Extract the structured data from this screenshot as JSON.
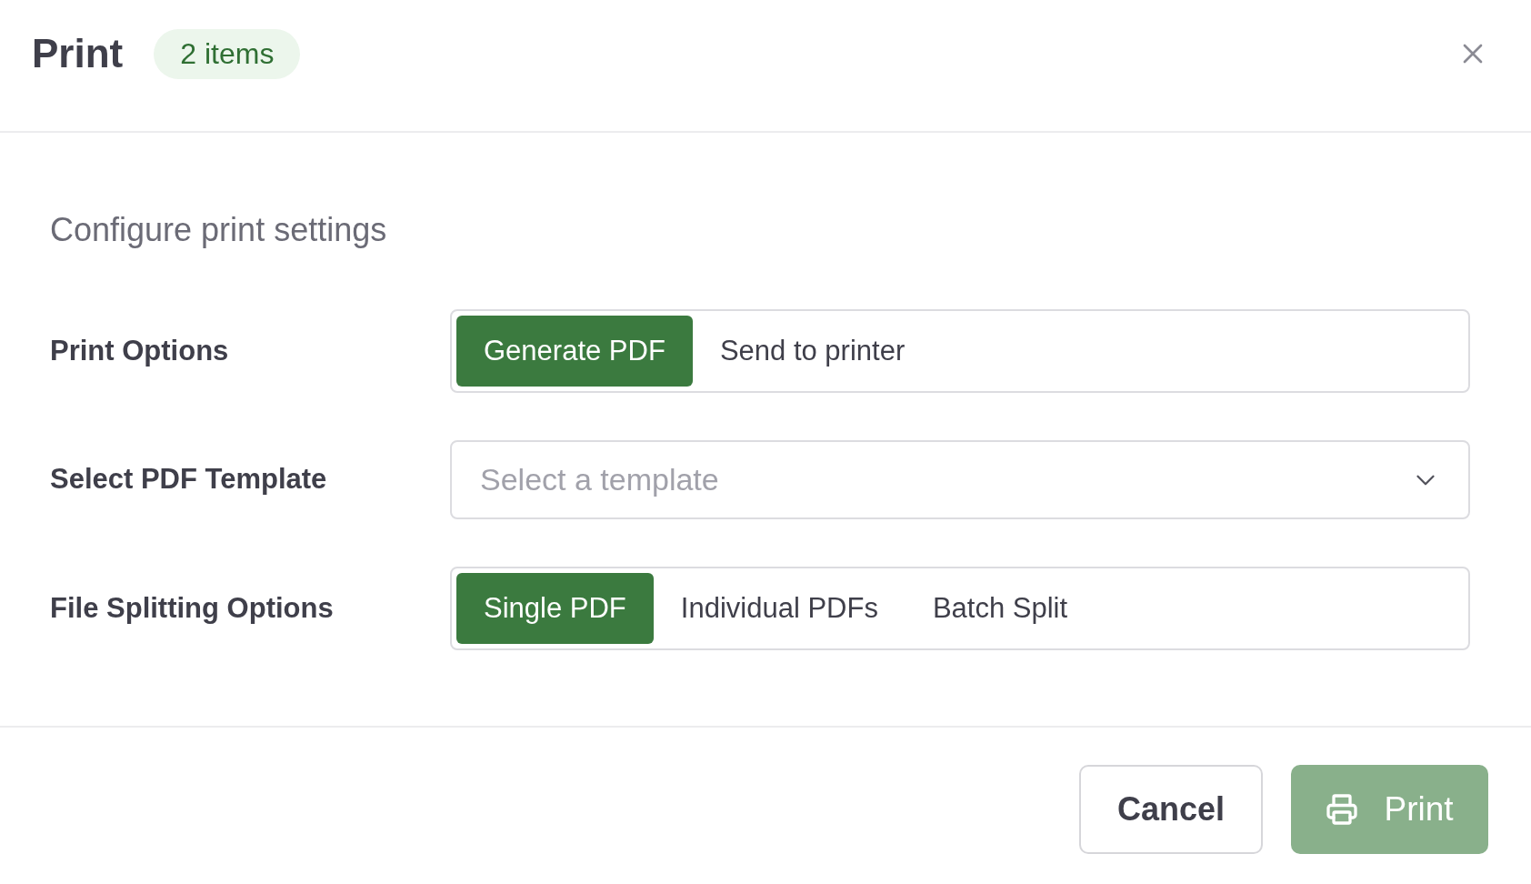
{
  "dialog": {
    "title": "Print",
    "badge": "2 items"
  },
  "description": "Configure print settings",
  "fields": [
    {
      "kind": "segmented",
      "label": "Print Options",
      "options": [
        {
          "label": "Generate PDF",
          "selected": true
        },
        {
          "label": "Send to printer",
          "selected": false
        }
      ]
    },
    {
      "kind": "select",
      "label": "Select PDF Template",
      "placeholder": "Select a template"
    },
    {
      "kind": "segmented",
      "label": "File Splitting Options",
      "options": [
        {
          "label": "Single PDF",
          "selected": true
        },
        {
          "label": "Individual PDFs",
          "selected": false
        },
        {
          "label": "Batch Split",
          "selected": false
        }
      ]
    }
  ],
  "footer": {
    "buttons": [
      {
        "kind": "secondary",
        "label": "Cancel",
        "disabled": false
      },
      {
        "kind": "primary",
        "label": "Print",
        "disabled": true
      }
    ]
  }
}
